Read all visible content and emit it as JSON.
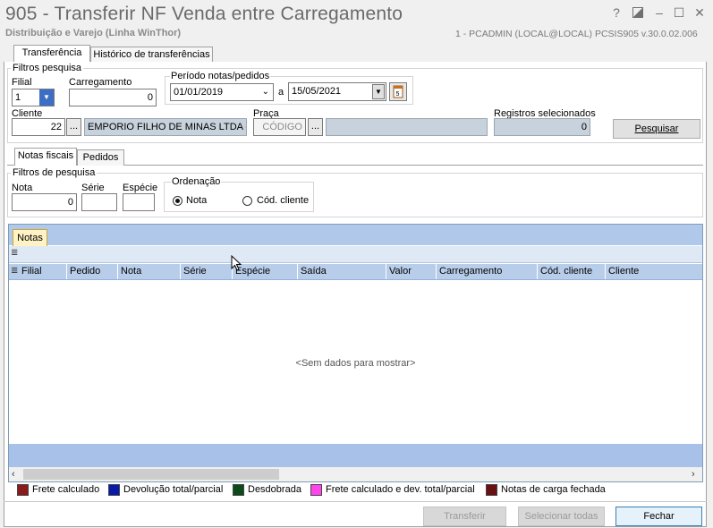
{
  "window": {
    "title": "905 - Transferir NF Venda entre Carregamento",
    "subtitle": "Distribuição e Varejo (Linha WinThor)",
    "user_info": "1 - PCADMIN (LOCAL@LOCAL)   PCSIS905  v.30.0.02.006",
    "help_label": "?",
    "min_label": "–",
    "max_label": "☐",
    "close_label": "✕"
  },
  "tabs": [
    "Transferência",
    "Histórico de transferências"
  ],
  "filtros": {
    "group_label": "Filtros pesquisa",
    "filial_label": "Filial",
    "filial_value": "1",
    "carregamento_label": "Carregamento",
    "carregamento_value": "0",
    "periodo_label": "Período notas/pedidos",
    "data_inicio": "01/01/2019",
    "a_label": "a",
    "data_fim": "15/05/2021",
    "cliente_label": "Cliente",
    "cliente_codigo": "22",
    "cliente_nome": "EMPORIO FILHO DE MINAS LTDA - E",
    "praca_label": "Praça",
    "praca_placeholder": "CÓDIGO",
    "registros_label": "Registros selecionados",
    "registros_value": "0",
    "pesquisar_label": "Pesquisar",
    "ellipsis": "..."
  },
  "subtabs": [
    "Notas fiscais",
    "Pedidos"
  ],
  "filtros_nf": {
    "group_label": "Filtros de pesquisa",
    "nota_label": "Nota",
    "nota_value": "0",
    "serie_label": "Série",
    "especie_label": "Espécie",
    "ordenacao_label": "Ordenação",
    "ord_nota": "Nota",
    "ord_cod_cliente": "Cód. cliente"
  },
  "grid": {
    "tab_label": "Notas",
    "columns": [
      "Filial",
      "Pedido",
      "Nota",
      "Série",
      "Espécie",
      "Saída",
      "Valor",
      "Carregamento",
      "Cód. cliente",
      "Cliente"
    ],
    "empty_text": "<Sem dados para mostrar>"
  },
  "legend": [
    {
      "label": "Frete calculado",
      "color": "#8b1a1a"
    },
    {
      "label": "Devolução total/parcial",
      "color": "#0a1aa8"
    },
    {
      "label": "Desdobrada",
      "color": "#0b4a1a"
    },
    {
      "label": "Frete calculado e dev. total/parcial",
      "color": "#ff44ee"
    },
    {
      "label": "Notas de carga fechada",
      "color": "#6b1010"
    }
  ],
  "footer": {
    "transferir_label": "Transferir",
    "selecionar_label": "Selecionar todas",
    "fechar_label": "Fechar"
  }
}
